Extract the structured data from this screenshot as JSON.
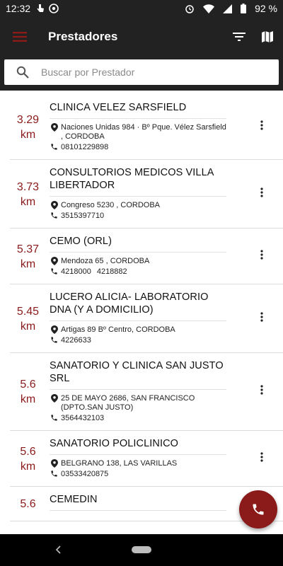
{
  "status_bar": {
    "time": "12:32",
    "battery": "92 %"
  },
  "app_bar": {
    "title": "Prestadores"
  },
  "search": {
    "placeholder": "Buscar por Prestador"
  },
  "colors": {
    "accent": "#8b1a1a",
    "bar": "#222222"
  },
  "items": [
    {
      "distance": "3.29",
      "unit": "km",
      "name": "CLINICA VELEZ SARSFIELD",
      "address": "Naciones Unidas 984 · Bº Pque. Vélez Sarsfield , CORDOBA",
      "phones": [
        "08101229898"
      ]
    },
    {
      "distance": "3.73",
      "unit": "km",
      "name": "CONSULTORIOS MEDICOS VILLA LIBERTADOR",
      "address": "Congreso 5230 , CORDOBA",
      "phones": [
        "3515397710"
      ]
    },
    {
      "distance": "5.37",
      "unit": "km",
      "name": "CEMO (ORL)",
      "address": "Mendoza 65 , CORDOBA",
      "phones": [
        "4218000",
        "4218882"
      ]
    },
    {
      "distance": "5.45",
      "unit": "km",
      "name": "LUCERO ALICIA- LABORATORIO DNA (Y A DOMICILIO)",
      "address": "Artigas 89 Bº Centro, CORDOBA",
      "phones": [
        "4226633"
      ]
    },
    {
      "distance": "5.6",
      "unit": "km",
      "name": "SANATORIO Y CLINICA SAN JUSTO SRL",
      "address": "25 DE MAYO 2686, SAN FRANCISCO (DPTO.SAN JUSTO)",
      "phones": [
        "3564432103"
      ]
    },
    {
      "distance": "5.6",
      "unit": "km",
      "name": "SANATORIO POLICLINICO",
      "address": "BELGRANO 138, LAS VARILLAS",
      "phones": [
        "03533420875"
      ]
    },
    {
      "distance": "5.6",
      "unit": "",
      "name": "CEMEDIN",
      "address": "",
      "phones": []
    }
  ]
}
